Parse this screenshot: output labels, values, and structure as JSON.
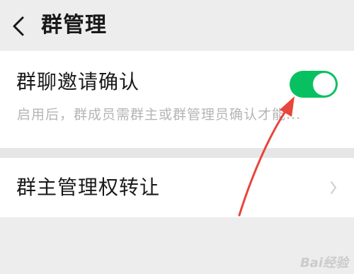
{
  "header": {
    "title": "群管理"
  },
  "settings": {
    "invite_confirm": {
      "label": "群聊邀请确认",
      "description": "启用后，群成员需群主或群管理员确认才能...",
      "enabled": true
    },
    "transfer_owner": {
      "label": "群主管理权转让"
    }
  },
  "colors": {
    "accent": "#07c160",
    "annotation_arrow": "#e8453c"
  },
  "watermark": {
    "text": "Bai经验"
  }
}
